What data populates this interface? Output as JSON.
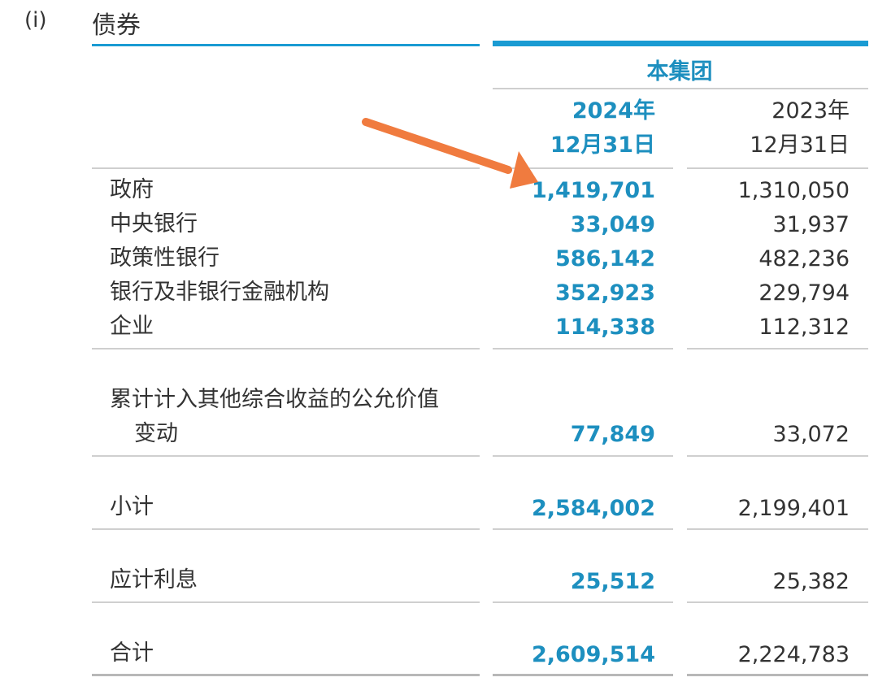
{
  "section": {
    "number": "(i)",
    "title": "债券"
  },
  "header": {
    "group": "本集团",
    "current_year": "2024年",
    "current_date": "12月31日",
    "prior_year": "2023年",
    "prior_date": "12月31日"
  },
  "rows": [
    {
      "label": "政府",
      "current": "1,419,701",
      "prior": "1,310,050"
    },
    {
      "label": "中央银行",
      "current": "33,049",
      "prior": "31,937"
    },
    {
      "label": "政策性银行",
      "current": "586,142",
      "prior": "482,236"
    },
    {
      "label": "银行及非银行金融机构",
      "current": "352,923",
      "prior": "229,794"
    },
    {
      "label": "企业",
      "current": "114,338",
      "prior": "112,312"
    }
  ],
  "fair_value": {
    "label_line1": "累计计入其他综合收益的公允价值",
    "label_line2": "变动",
    "current": "77,849",
    "prior": "33,072"
  },
  "subtotal": {
    "label": "小计",
    "current": "2,584,002",
    "prior": "2,199,401"
  },
  "accrued_interest": {
    "label": "应计利息",
    "current": "25,512",
    "prior": "25,382"
  },
  "total": {
    "label": "合计",
    "current": "2,609,514",
    "prior": "2,224,783"
  },
  "colors": {
    "accent_blue": "#1d8fbf",
    "arrow_orange": "#f07b3f"
  }
}
